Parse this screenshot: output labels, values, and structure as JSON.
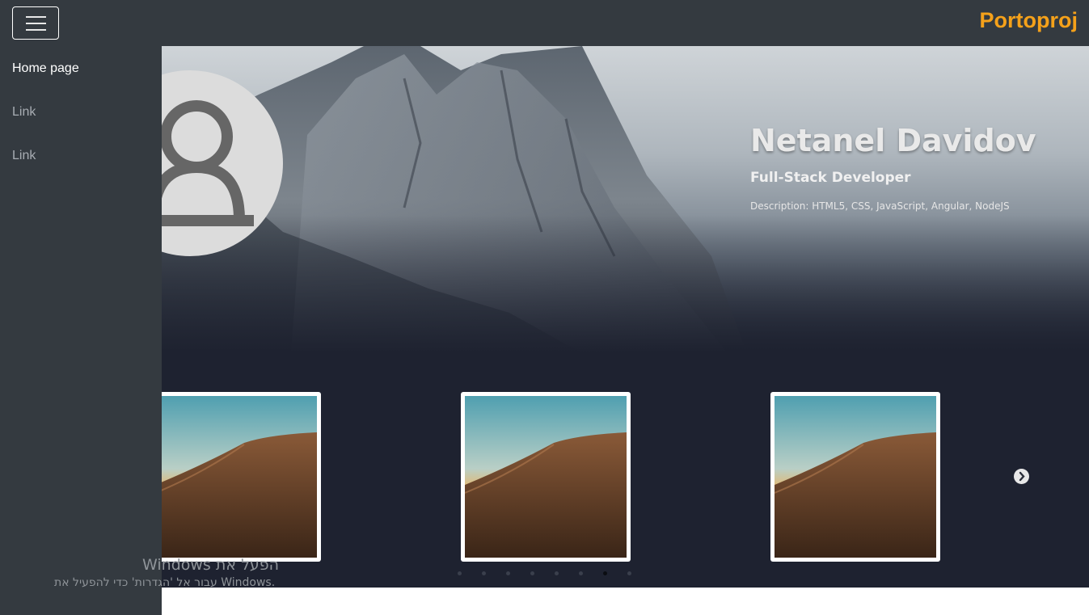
{
  "navbar": {
    "brand": "Portoproj",
    "brand_color": "#f5a11a",
    "toggle_icon": "hamburger-menu-icon"
  },
  "sidebar": {
    "items": [
      {
        "label": "Home page",
        "active": true
      },
      {
        "label": "Link",
        "active": false
      },
      {
        "label": "Link",
        "active": false
      }
    ]
  },
  "hero": {
    "name": "Netanel Davidov",
    "role": "Full-Stack Developer",
    "description": "Description: HTML5, CSS, JavaScript, Angular, NodeJS",
    "avatar_icon": "user-silhouette-icon"
  },
  "carousel": {
    "card_count": 3,
    "card_image": "desert-dunes-image",
    "next_icon": "chevron-right-circle-icon",
    "indicator_count": 8,
    "active_indicator": 7
  },
  "watermark": {
    "line1": "הפעל את Windows",
    "line2": "עבור אל 'הגדרות' כדי להפעיל את Windows."
  }
}
